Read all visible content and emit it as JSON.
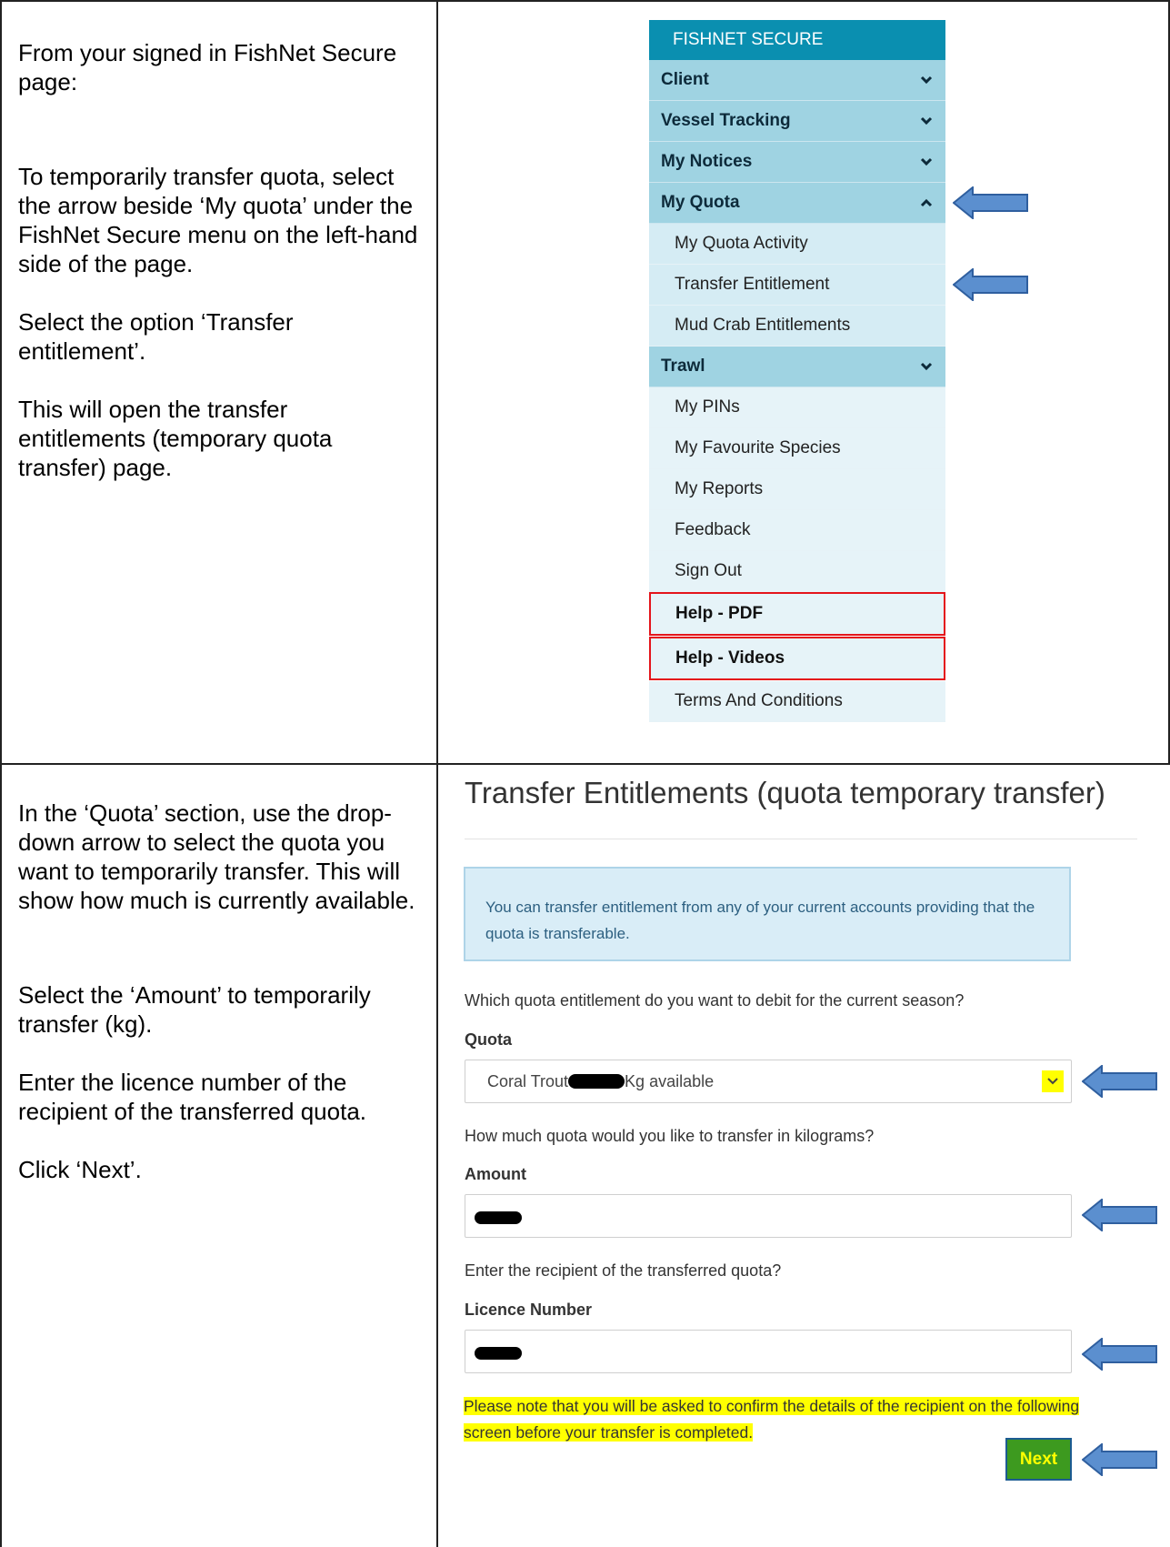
{
  "instructions": {
    "step1": [
      "From your signed in FishNet Secure page:",
      "To temporarily transfer quota, select the arrow beside ‘My quota’ under the FishNet Secure menu on the left-hand side of the page.",
      "Select the option ‘Transfer entitlement’.",
      "This will open the transfer entitlements (temporary quota transfer) page."
    ],
    "step2": [
      "In the ‘Quota’ section, use the drop-down arrow to select the quota you want to temporarily transfer. This will show how much is currently available.",
      "Select the ‘Amount’ to temporarily transfer (kg).",
      "Enter the licence number of the recipient of the transferred quota.",
      "Click ‘Next’."
    ]
  },
  "menu": {
    "title": "FISHNET SECURE",
    "client": "Client",
    "vessel_tracking": "Vessel Tracking",
    "my_notices": "My Notices",
    "my_quota": "My Quota",
    "my_quota_activity": "My Quota Activity",
    "transfer_entitlement": "Transfer Entitlement",
    "mud_crab": "Mud Crab Entitlements",
    "trawl": "Trawl",
    "my_pins": "My PINs",
    "favourite_species": "My Favourite Species",
    "my_reports": "My Reports",
    "feedback": "Feedback",
    "sign_out": "Sign Out",
    "help_pdf": "Help - PDF",
    "help_videos": "Help - Videos",
    "terms": "Terms And Conditions"
  },
  "form": {
    "title": "Transfer Entitlements (quota temporary transfer)",
    "info": "You can transfer entitlement from any of your current accounts providing that the quota is transferable.",
    "quota_question": "Which quota entitlement do you want to debit for the current season?",
    "quota_label": "Quota",
    "quota_value_prefix": "Coral Trout",
    "quota_value_suffix": "Kg available",
    "amount_question": "How much quota would you like to transfer in kilograms?",
    "amount_label": "Amount",
    "recipient_question": "Enter the recipient of the transferred quota?",
    "licence_label": "Licence Number",
    "note": "Please note that you will be asked to confirm the details of the recipient on the following screen before your transfer is completed.",
    "next": "Next"
  },
  "colors": {
    "menu_header": "#0a8fb0",
    "menu_section": "#9fd3e2",
    "highlight": "#ffff00",
    "help_border": "#e4141b",
    "arrow_fill": "#5b8fcf",
    "next_button": "#3d9a1f"
  }
}
